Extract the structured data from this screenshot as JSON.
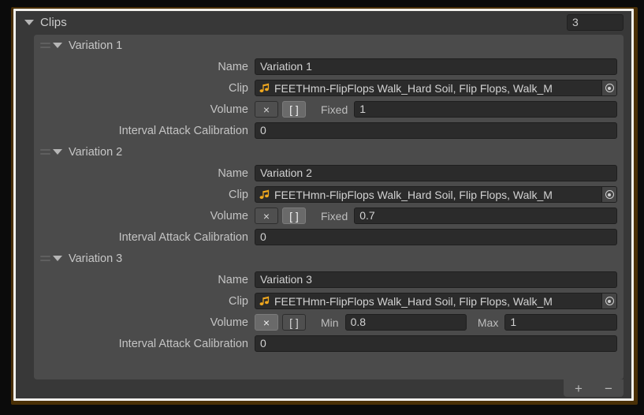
{
  "theme": {
    "highlight_border": "#4a3006",
    "highlight_inner": "#f2f0ec",
    "panel_bg": "#383838",
    "list_bg": "#4b4b4b",
    "field_bg": "#2b2b2b",
    "text": "#c4c4c4",
    "clip_icon_color": "#f0a81e"
  },
  "header": {
    "title": "Clips",
    "foldout_icon": "triangle-down-icon",
    "size_value": "3"
  },
  "labels": {
    "name": "Name",
    "clip": "Clip",
    "volume": "Volume",
    "interval_attack_calibration": "Interval Attack Calibration",
    "fixed": "Fixed",
    "min": "Min",
    "max": "Max"
  },
  "buttons": {
    "clear": "×",
    "range": "[ ]",
    "add": "+",
    "remove": "−"
  },
  "variations": [
    {
      "title": "Variation 1",
      "drag_handle_icon": "drag-handle-icon",
      "foldout_icon": "triangle-down-icon",
      "name_value": "Variation 1",
      "clip_value": "FEETHmn-FlipFlops Walk_Hard Soil, Flip Flops, Walk_M",
      "clip_icon": "audio-clip-icon",
      "picker_icon": "object-picker-icon",
      "volume_mode": "fixed",
      "volume_fixed": "1",
      "volume_min": "",
      "volume_max": "",
      "clear_active": false,
      "range_active": true,
      "interval_attack_calibration_value": "0"
    },
    {
      "title": "Variation 2",
      "drag_handle_icon": "drag-handle-icon",
      "foldout_icon": "triangle-down-icon",
      "name_value": "Variation 2",
      "clip_value": "FEETHmn-FlipFlops Walk_Hard Soil, Flip Flops, Walk_M",
      "clip_icon": "audio-clip-icon",
      "picker_icon": "object-picker-icon",
      "volume_mode": "fixed",
      "volume_fixed": "0.7",
      "volume_min": "",
      "volume_max": "",
      "clear_active": false,
      "range_active": true,
      "interval_attack_calibration_value": "0"
    },
    {
      "title": "Variation 3",
      "drag_handle_icon": "drag-handle-icon",
      "foldout_icon": "triangle-down-icon",
      "name_value": "Variation 3",
      "clip_value": "FEETHmn-FlipFlops Walk_Hard Soil, Flip Flops, Walk_M",
      "clip_icon": "audio-clip-icon",
      "picker_icon": "object-picker-icon",
      "volume_mode": "range",
      "volume_fixed": "",
      "volume_min": "0.8",
      "volume_max": "1",
      "clear_active": true,
      "range_active": false,
      "interval_attack_calibration_value": "0"
    }
  ]
}
